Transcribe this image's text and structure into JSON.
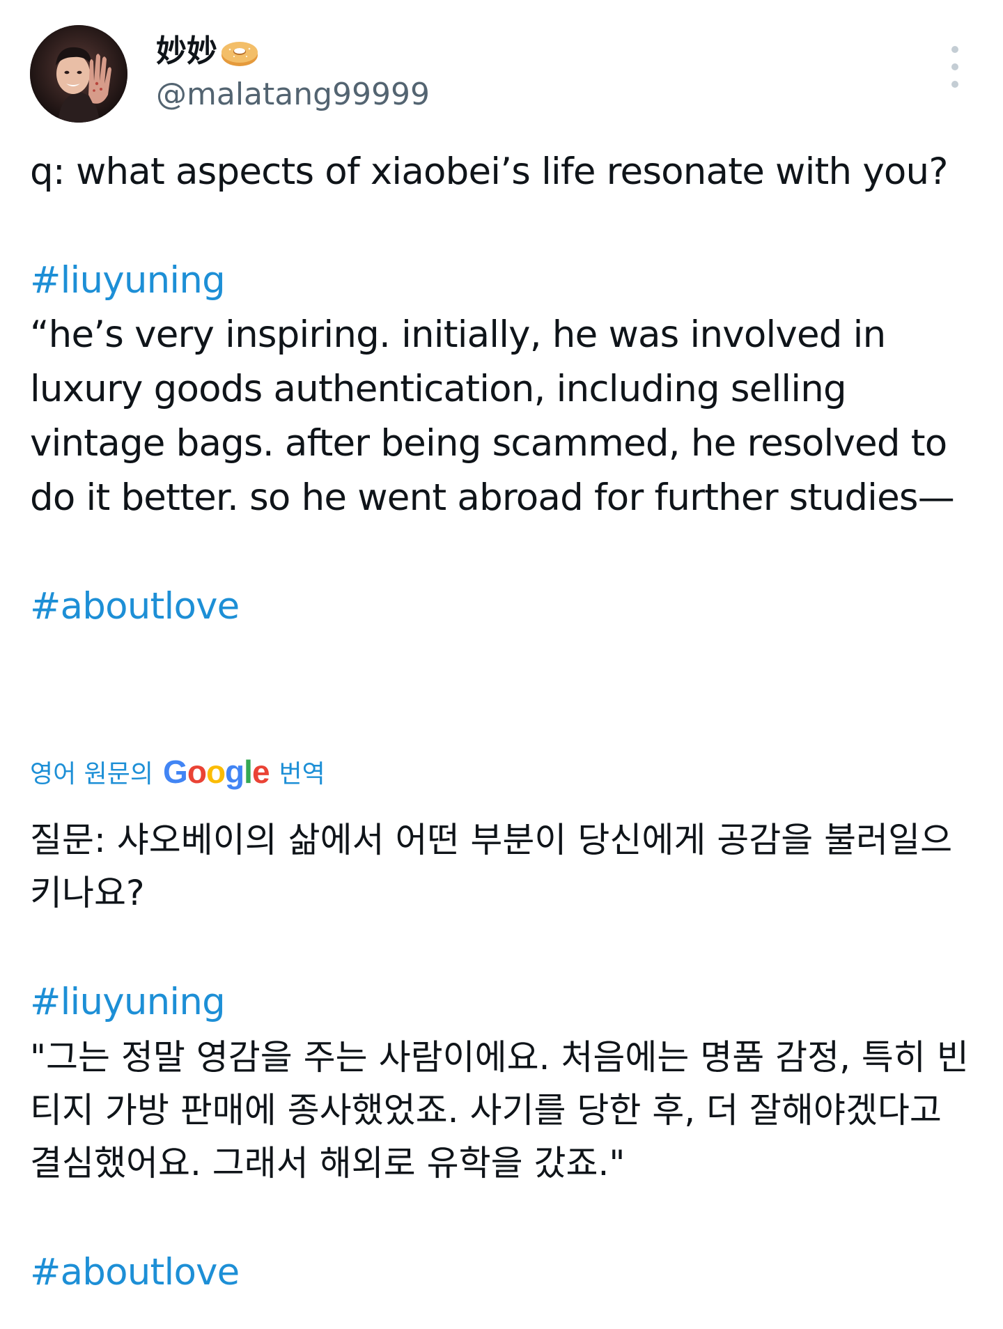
{
  "user": {
    "display_name": "妙妙",
    "handle": "@malatang99999",
    "name_emoji": "bagel-icon"
  },
  "tweet": {
    "original": {
      "line1": "q: what aspects of xiaobei’s life resonate with you?",
      "hashtag1": "#liuyuning",
      "quote": "“he’s very inspiring. initially, he was involved in luxury goods authentication, including selling vintage bags. after being scammed, he resolved to do it better. so he went abroad for further studies—",
      "hashtag2": "#aboutlove"
    },
    "translation_label": {
      "prefix": "영어 원문의",
      "brand": "Google",
      "suffix": "번역"
    },
    "translated": {
      "line1": "질문: 샤오베이의 삶에서 어떤 부분이 당신에게 공감을 불러일으키나요?",
      "hashtag1": "#liuyuning",
      "quote": "\"그는 정말 영감을 주는 사람이에요. 처음에는 명품 감정, 특히 빈티지 가방 판매에 종사했었죠. 사기를 당한 후, 더 잘해야겠다고 결심했어요. 그래서 해외로 유학을 갔죠.\"",
      "hashtag2": "#aboutlove"
    }
  },
  "colors": {
    "link": "#1d8fd6",
    "text": "#0f1419",
    "secondary": "#536471"
  }
}
